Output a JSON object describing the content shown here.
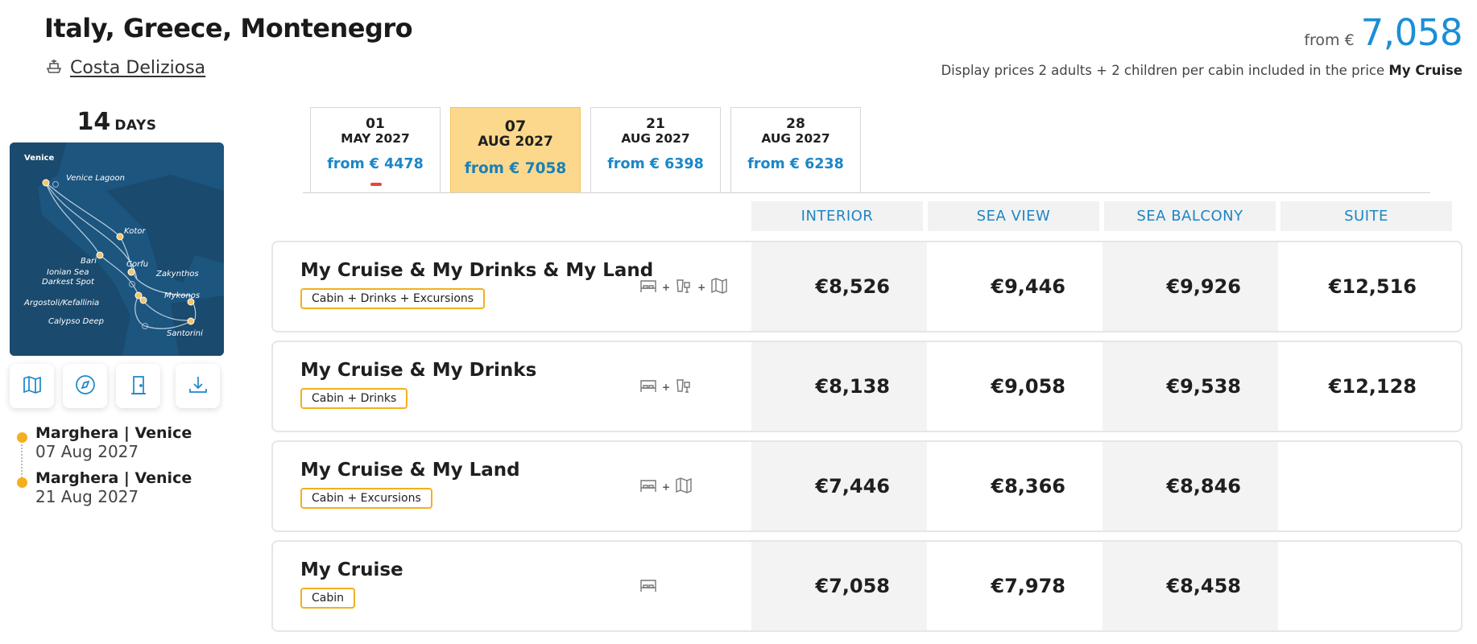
{
  "header": {
    "title": "Italy, Greece, Montenegro",
    "ship_name": "Costa Deliziosa",
    "price_prefix": "from €",
    "price_value": "7,058",
    "price_note": "Display prices 2 adults + 2 children per cabin included in the price",
    "price_note_bold": "My Cruise"
  },
  "duration": {
    "number": "14",
    "label": "DAYS"
  },
  "map": {
    "labels": [
      "Venice",
      "Venice Lagoon",
      "Kotor",
      "Bari",
      "Corfu",
      "Zakynthos",
      "Ionian Sea",
      "Darkest Spot",
      "Mykonos",
      "Argostoli/Kefallinia",
      "Calypso Deep",
      "Santorini"
    ]
  },
  "map_tools": [
    {
      "icon": "map-icon"
    },
    {
      "icon": "compass-icon"
    },
    {
      "icon": "door-icon"
    },
    {
      "icon": "download-icon"
    }
  ],
  "itinerary": [
    {
      "port": "Marghera | Venice",
      "date": "07 Aug 2027"
    },
    {
      "port": "Marghera | Venice",
      "date": "21 Aug 2027"
    }
  ],
  "date_tabs": [
    {
      "day": "01",
      "month": "MAY 2027",
      "price": "from € 4478",
      "active": false
    },
    {
      "day": "07",
      "month": "AUG 2027",
      "price": "from € 7058",
      "active": true
    },
    {
      "day": "21",
      "month": "AUG 2027",
      "price": "from € 6398",
      "active": false
    },
    {
      "day": "28",
      "month": "AUG 2027",
      "price": "from € 6238",
      "active": false
    }
  ],
  "columns": [
    "INTERIOR",
    "SEA VIEW",
    "SEA BALCONY",
    "SUITE"
  ],
  "packages": [
    {
      "name": "My Cruise & My Drinks & My Land",
      "badge": "Cabin + Drinks + Excursions",
      "icons": [
        "bed-icon",
        "drinks-icon",
        "map-excursion-icon"
      ],
      "prices": [
        "€8,526",
        "€9,446",
        "€9,926",
        "€12,516"
      ]
    },
    {
      "name": "My Cruise & My Drinks",
      "badge": "Cabin + Drinks",
      "icons": [
        "bed-icon",
        "drinks-icon"
      ],
      "prices": [
        "€8,138",
        "€9,058",
        "€9,538",
        "€12,128"
      ]
    },
    {
      "name": "My Cruise & My Land",
      "badge": "Cabin + Excursions",
      "icons": [
        "bed-icon",
        "map-excursion-icon"
      ],
      "prices": [
        "€7,446",
        "€8,366",
        "€8,846",
        ""
      ]
    },
    {
      "name": "My Cruise",
      "badge": "Cabin",
      "icons": [
        "bed-icon"
      ],
      "prices": [
        "€7,058",
        "€7,978",
        "€8,458",
        ""
      ]
    }
  ],
  "plus_sign": "+"
}
